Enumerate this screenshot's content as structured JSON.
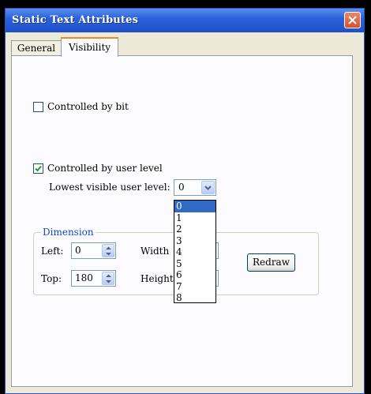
{
  "window": {
    "title": "Static Text Attributes"
  },
  "tabs": [
    {
      "label": "General",
      "active": false
    },
    {
      "label": "Visibility",
      "active": true
    }
  ],
  "controlled_by_bit": {
    "label": "Controlled by bit",
    "checked": false
  },
  "controlled_by_user_level": {
    "label": "Controlled by user level",
    "checked": true
  },
  "lowest_visible_user_level": {
    "label": "Lowest visible user level:",
    "selected": "0",
    "options": [
      "0",
      "1",
      "2",
      "3",
      "4",
      "5",
      "6",
      "7",
      "8"
    ]
  },
  "dimension": {
    "title": "Dimension",
    "left_label": "Left:",
    "left_value": "0",
    "top_label": "Top:",
    "top_value": "180",
    "width_label": "Width",
    "width_value": "",
    "height_label": "Height:",
    "height_value": ""
  },
  "redraw_button": {
    "label": "Redraw"
  },
  "colors": {
    "titlebar": "#2C62DA",
    "dialog_bg": "#ECE9D8",
    "selection": "#316AC5",
    "group_title": "#1A46C4"
  }
}
